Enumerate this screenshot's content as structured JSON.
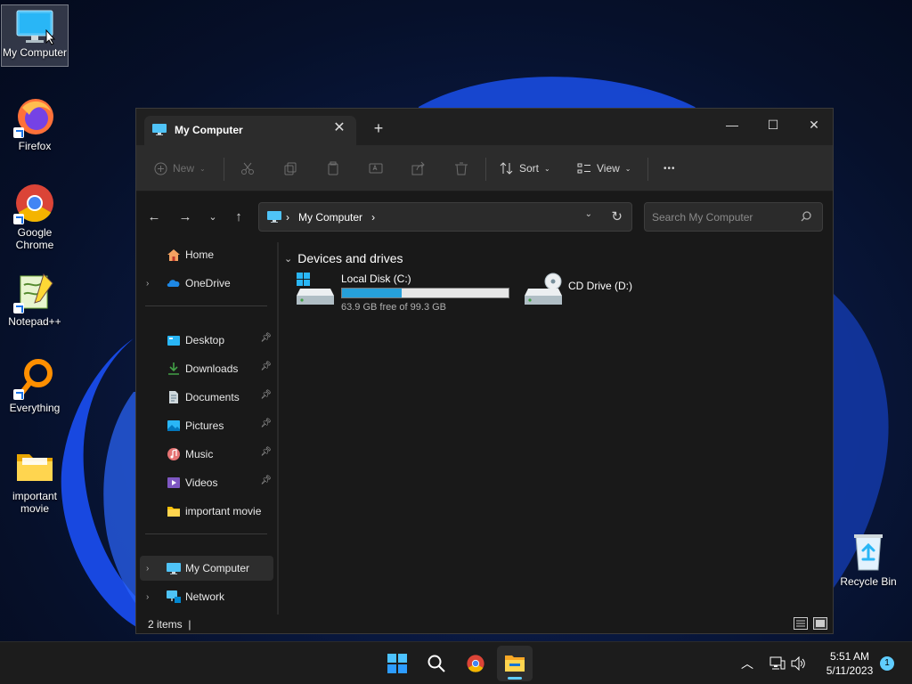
{
  "desktop": {
    "icons": [
      {
        "label": "My Computer",
        "icon": "monitor-icon"
      },
      {
        "label": "Firefox",
        "icon": "firefox-icon"
      },
      {
        "label": "Google Chrome",
        "icon": "chrome-icon"
      },
      {
        "label": "Notepad++",
        "icon": "notepadpp-icon"
      },
      {
        "label": "Everything",
        "icon": "search-magnifier-icon"
      },
      {
        "label": "important movie",
        "icon": "folder-icon"
      },
      {
        "label": "Recycle Bin",
        "icon": "recycle-bin-icon"
      }
    ]
  },
  "window": {
    "tab_title": "My Computer",
    "toolbar": {
      "new_label": "New",
      "sort_label": "Sort",
      "view_label": "View",
      "more_label": "•••"
    },
    "address": {
      "separator": "›",
      "path": "My Computer",
      "trailing": "›"
    },
    "search": {
      "placeholder": "Search My Computer"
    },
    "sidebar": {
      "items": [
        {
          "label": "Home",
          "icon": "home-icon"
        },
        {
          "label": "OneDrive",
          "icon": "onedrive-icon"
        },
        {
          "label": "Desktop",
          "icon": "desktop-icon",
          "pinned": true
        },
        {
          "label": "Downloads",
          "icon": "download-icon",
          "pinned": true
        },
        {
          "label": "Documents",
          "icon": "documents-icon",
          "pinned": true
        },
        {
          "label": "Pictures",
          "icon": "pictures-icon",
          "pinned": true
        },
        {
          "label": "Music",
          "icon": "music-icon",
          "pinned": true
        },
        {
          "label": "Videos",
          "icon": "videos-icon",
          "pinned": true
        },
        {
          "label": "important movie",
          "icon": "folder-icon"
        },
        {
          "label": "My Computer",
          "icon": "monitor-icon",
          "active": true
        },
        {
          "label": "Network",
          "icon": "network-icon"
        }
      ]
    },
    "content": {
      "group_header": "Devices and drives",
      "drives": [
        {
          "label": "Local Disk (C:)",
          "free_text": "63.9 GB free of 99.3 GB",
          "used_fraction": 0.357
        },
        {
          "label": "CD Drive (D:)"
        }
      ]
    },
    "status": {
      "item_count": "2 items",
      "cursor": "|"
    }
  },
  "taskbar": {
    "apps": [
      "start-icon",
      "search-icon",
      "chrome-icon",
      "file-explorer-icon"
    ],
    "time": "5:51 AM",
    "date": "5/11/2023",
    "notification_count": "1"
  },
  "colors": {
    "accent": "#60cdff",
    "drive_bar": "#26a0da",
    "window_bg": "#191919",
    "toolbar_bg": "#2c2c2c"
  }
}
